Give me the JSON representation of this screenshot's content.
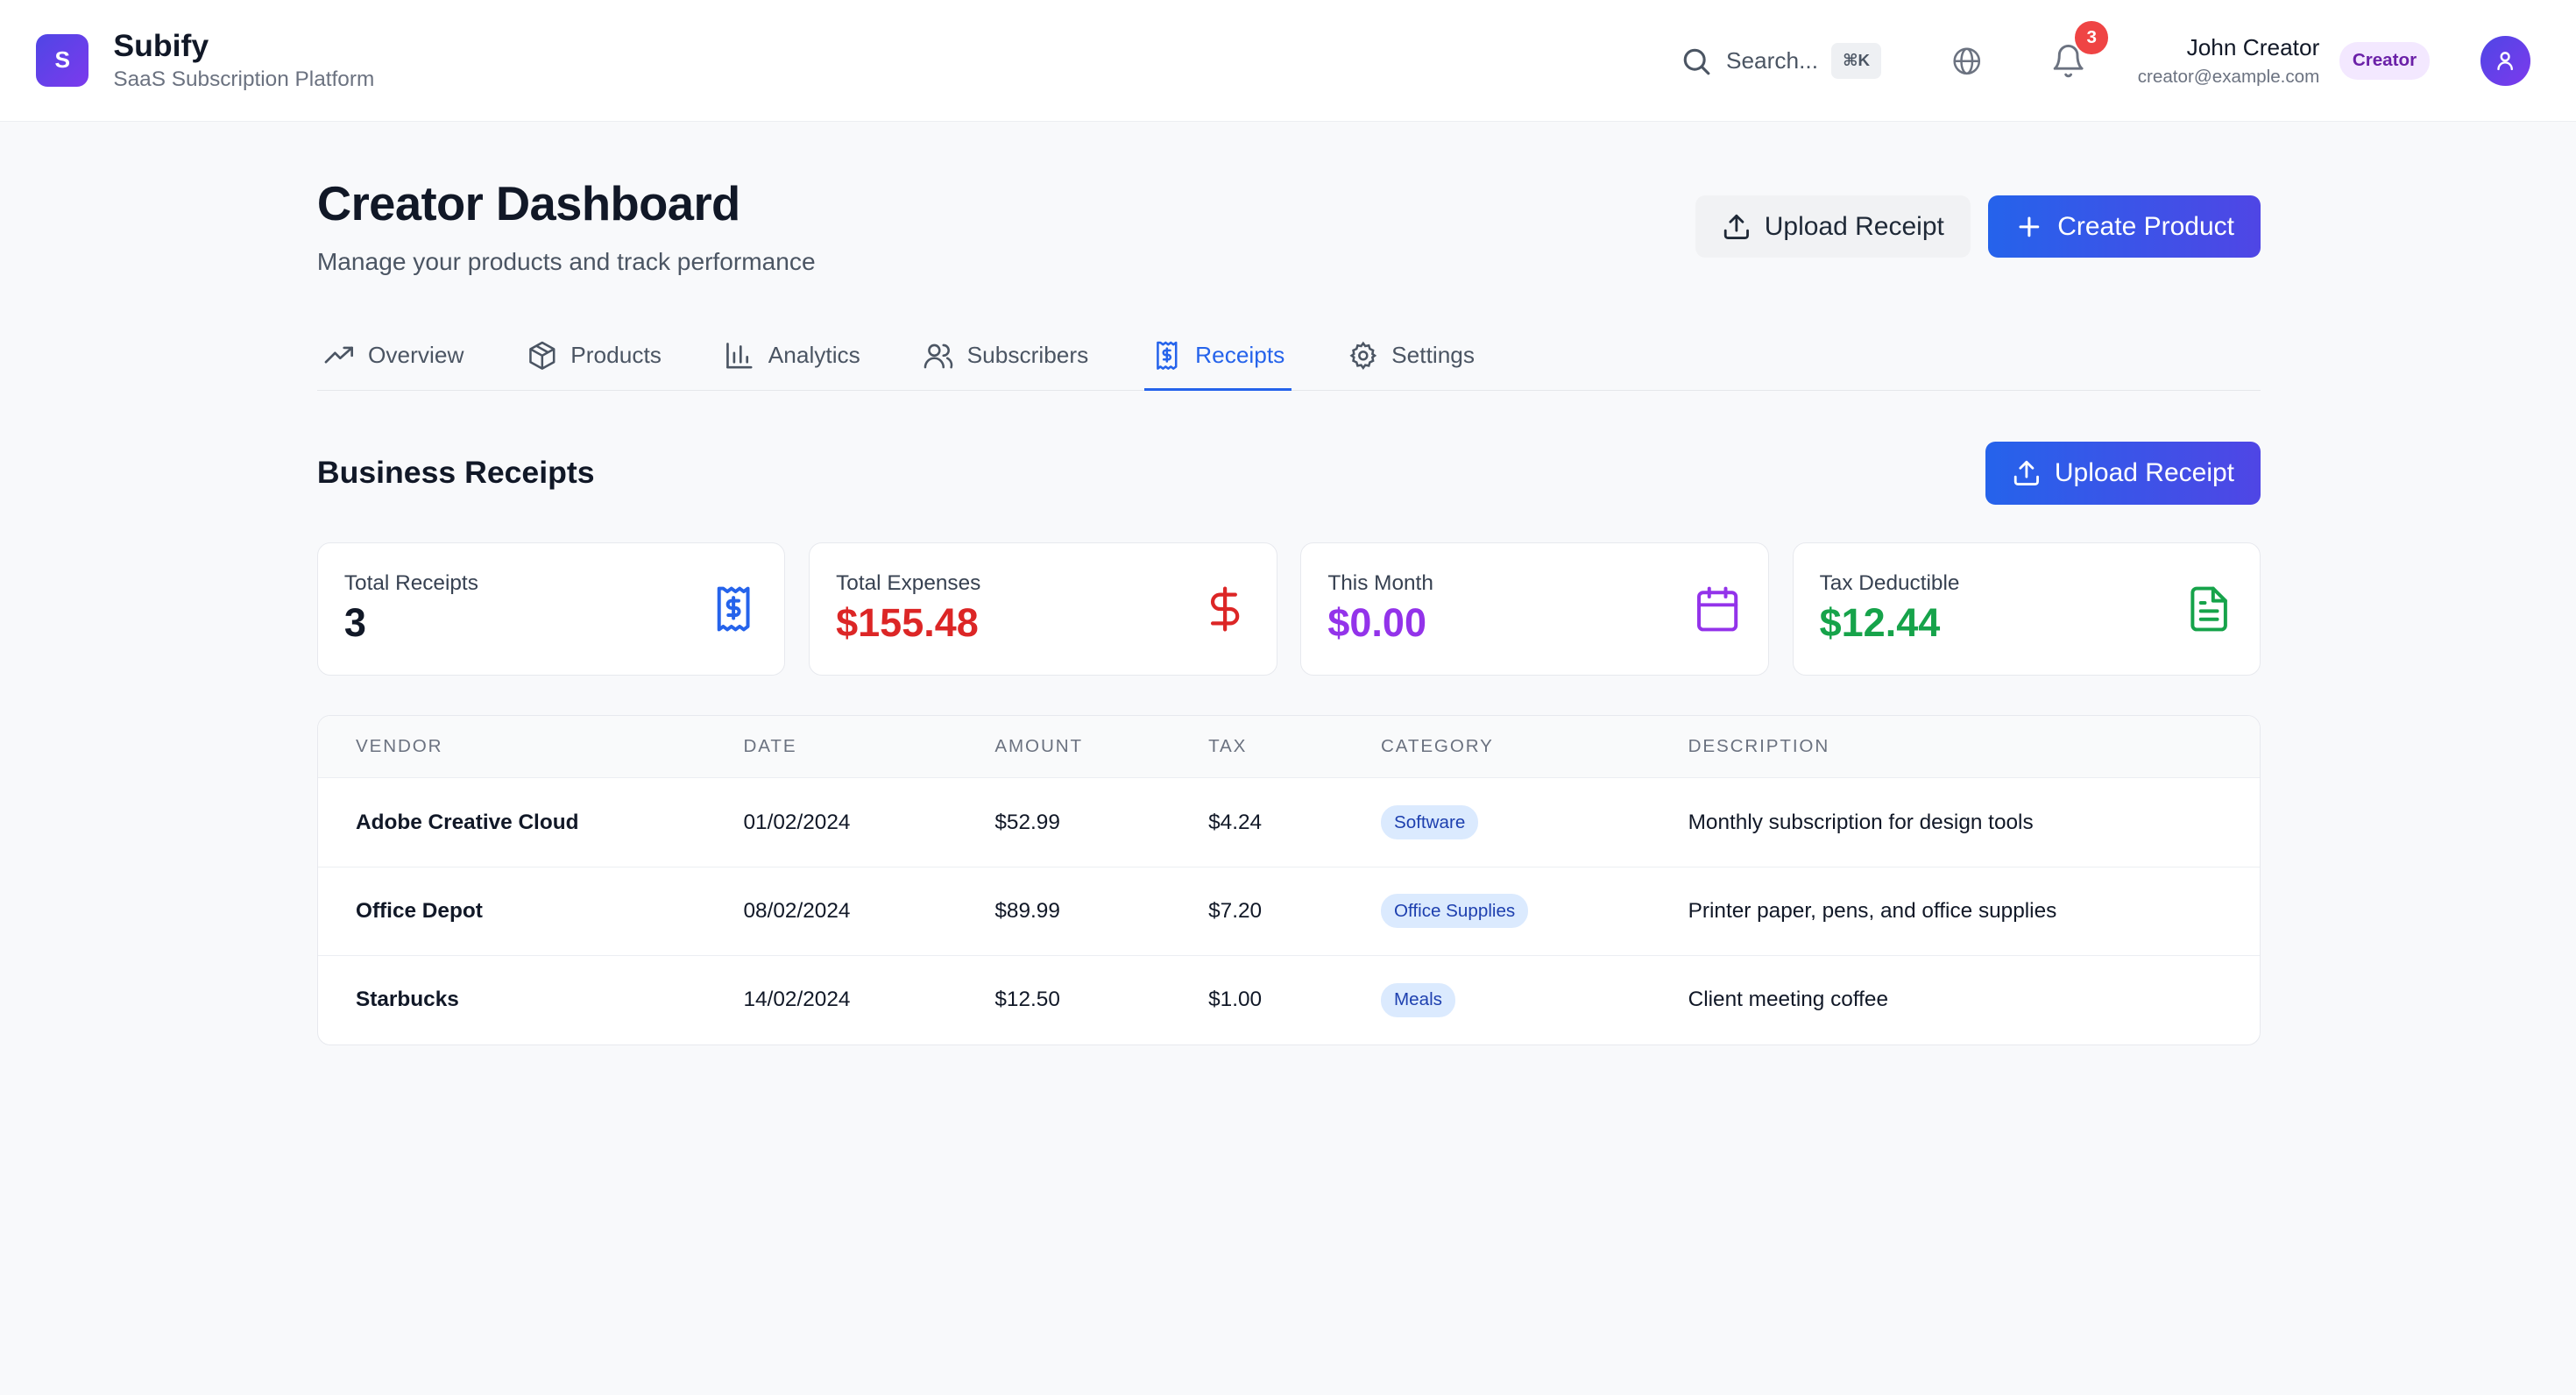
{
  "app": {
    "logo_letter": "S",
    "name": "Subify",
    "tagline": "SaaS Subscription Platform"
  },
  "header": {
    "search_placeholder": "Search...",
    "search_shortcut": "⌘K",
    "notification_count": "3",
    "user_name": "John Creator",
    "user_email": "creator@example.com",
    "user_role": "Creator"
  },
  "page": {
    "title": "Creator Dashboard",
    "subtitle": "Manage your products and track performance",
    "upload_receipt_label": "Upload Receipt",
    "create_product_label": "Create Product"
  },
  "tabs": [
    {
      "label": "Overview",
      "icon": "trending-up-icon",
      "active": false
    },
    {
      "label": "Products",
      "icon": "package-icon",
      "active": false
    },
    {
      "label": "Analytics",
      "icon": "bar-chart-icon",
      "active": false
    },
    {
      "label": "Subscribers",
      "icon": "users-icon",
      "active": false
    },
    {
      "label": "Receipts",
      "icon": "receipt-icon",
      "active": true
    },
    {
      "label": "Settings",
      "icon": "gear-icon",
      "active": false
    }
  ],
  "receipts": {
    "section_title": "Business Receipts",
    "upload_label": "Upload Receipt",
    "stats": [
      {
        "label": "Total Receipts",
        "value": "3",
        "color": "#111827",
        "icon": "receipt-icon",
        "icon_color": "#2563eb"
      },
      {
        "label": "Total Expenses",
        "value": "$155.48",
        "color": "#dc2626",
        "icon": "dollar-icon",
        "icon_color": "#dc2626"
      },
      {
        "label": "This Month",
        "value": "$0.00",
        "color": "#9333ea",
        "icon": "calendar-icon",
        "icon_color": "#9333ea"
      },
      {
        "label": "Tax Deductible",
        "value": "$12.44",
        "color": "#16a34a",
        "icon": "file-text-icon",
        "icon_color": "#16a34a"
      }
    ],
    "columns": [
      "VENDOR",
      "DATE",
      "AMOUNT",
      "TAX",
      "CATEGORY",
      "DESCRIPTION"
    ],
    "rows": [
      {
        "vendor": "Adobe Creative Cloud",
        "date": "01/02/2024",
        "amount": "$52.99",
        "tax": "$4.24",
        "category": "Software",
        "description": "Monthly subscription for design tools"
      },
      {
        "vendor": "Office Depot",
        "date": "08/02/2024",
        "amount": "$89.99",
        "tax": "$7.20",
        "category": "Office Supplies",
        "description": "Printer paper, pens, and office supplies"
      },
      {
        "vendor": "Starbucks",
        "date": "14/02/2024",
        "amount": "$12.50",
        "tax": "$1.00",
        "category": "Meals",
        "description": "Client meeting coffee"
      }
    ]
  }
}
